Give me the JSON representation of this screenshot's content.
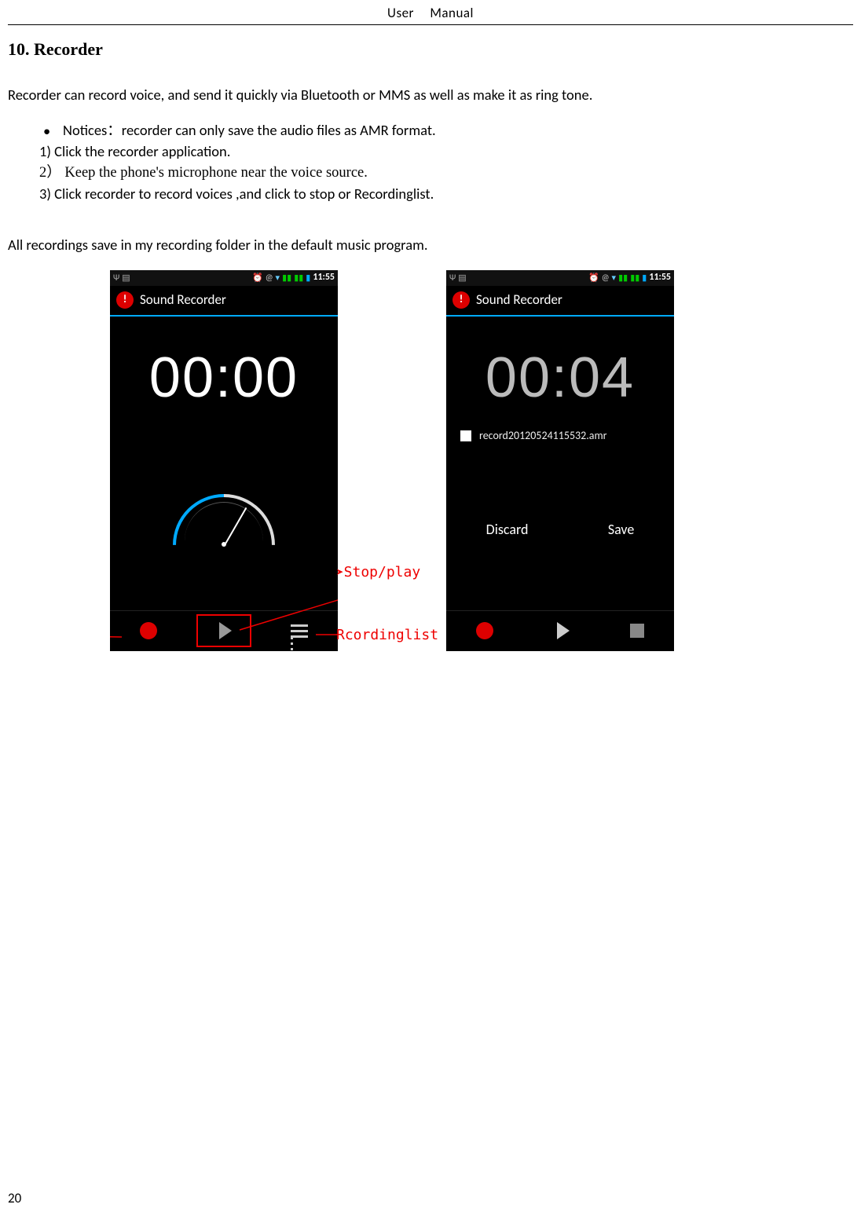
{
  "header": {
    "left": "User",
    "right": "Manual"
  },
  "section_title": "10. Recorder",
  "intro": "Recorder can record voice, and send it quickly via Bluetooth or MMS as well as make it as ring tone.",
  "notice": "Notices：recorder can only save the audio files as AMR format.",
  "steps": {
    "s1": "1) Click the recorder application.",
    "s2": "2） Keep the phone's microphone near the voice source.",
    "s3": "3) Click recorder to record voices ,and click to stop or Recordinglist."
  },
  "note_line": "All recordings save in my recording folder in the default music program.",
  "status_time": "11:55",
  "phone1": {
    "app_title": "Sound Recorder",
    "timer": "00:00"
  },
  "phone2": {
    "app_title": "Sound Recorder",
    "timer": "00:04",
    "filename": "record20120524115532.amr",
    "discard": "Discard",
    "save": "Save"
  },
  "annotations": {
    "stop_play": "Stop/play",
    "recording_list": "Rcordinglist"
  },
  "page_number": "20"
}
